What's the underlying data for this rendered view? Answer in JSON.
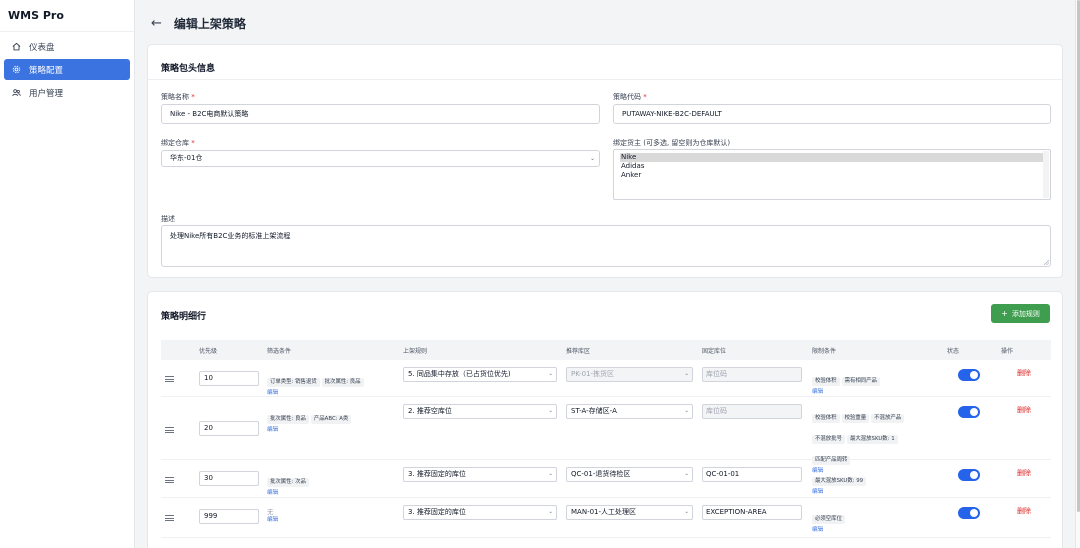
{
  "app": {
    "brand": "WMS Pro"
  },
  "sidebar": {
    "items": [
      {
        "label": "仪表盘",
        "icon": "home-icon",
        "active": false
      },
      {
        "label": "策略配置",
        "icon": "gear-icon",
        "active": true
      },
      {
        "label": "用户管理",
        "icon": "users-icon",
        "active": false
      }
    ]
  },
  "header": {
    "title": "编辑上架策略",
    "back_icon": "arrow-left-icon"
  },
  "header_section": {
    "title": "策略包头信息",
    "name_label": "策略名称",
    "name_value": "Nike - B2C电商默认策略",
    "code_label": "策略代码",
    "code_value": "PUTAWAY-NIKE-B2C-DEFAULT",
    "warehouse_label": "绑定仓库",
    "warehouse_value": "华东-01仓",
    "owner_label": "绑定货主 (可多选, 留空则为仓库默认)",
    "owners": [
      "Nike",
      "Adidas",
      "Anker"
    ],
    "owner_selected": "Nike",
    "desc_label": "描述",
    "desc_value": "处理Nike所有B2C业务的标准上架流程",
    "required_mark": "*"
  },
  "rules_section": {
    "title": "策略明细行",
    "add_button": "添加规则",
    "columns": [
      "优先级",
      "筛选条件",
      "上架规则",
      "推荐库区",
      "固定库位",
      "限制条件",
      "状态",
      "操作"
    ],
    "edit_label": "编辑",
    "delete_label": "删除",
    "rows": [
      {
        "priority": "10",
        "conditions": [
          "订单类型: 销售退货",
          "批次属性: 良品"
        ],
        "rule": "5. 同品集中存放（已占货位优先)",
        "zone": "PK-01-拣货区",
        "zone_disabled": true,
        "location": "库位码",
        "location_disabled": true,
        "limits": [
          "校验体积",
          "需有相同产品"
        ],
        "enabled": true
      },
      {
        "priority": "20",
        "conditions": [
          "批次属性: 良品",
          "产品ABC: A类"
        ],
        "rule": "2. 推荐空库位",
        "zone": "ST-A-存储区-A",
        "zone_disabled": false,
        "location": "库位码",
        "location_disabled": true,
        "limits": [
          "校验体积",
          "校验重量",
          "不混放产品",
          "不混放批号",
          "最大混放SKU数: 1",
          "匹配产品周转"
        ],
        "enabled": true
      },
      {
        "priority": "30",
        "conditions": [
          "批次属性: 次品"
        ],
        "rule": "3. 推荐固定的库位",
        "zone": "QC-01-退货待检区",
        "zone_disabled": false,
        "location": "QC-01-01",
        "location_disabled": false,
        "limits": [
          "最大混放SKU数: 99"
        ],
        "enabled": true
      },
      {
        "priority": "999",
        "conditions": [],
        "no_condition": "无",
        "rule": "3. 推荐固定的库位",
        "zone": "MAN-01-人工处理区",
        "zone_disabled": false,
        "location": "EXCEPTION-AREA",
        "location_disabled": false,
        "limits": [
          "必须空库位"
        ],
        "enabled": true
      }
    ]
  },
  "colors": {
    "accent": "#3b73e0",
    "add_button": "#3f9d4f",
    "danger": "#dc2626",
    "toggle": "#2563eb"
  }
}
